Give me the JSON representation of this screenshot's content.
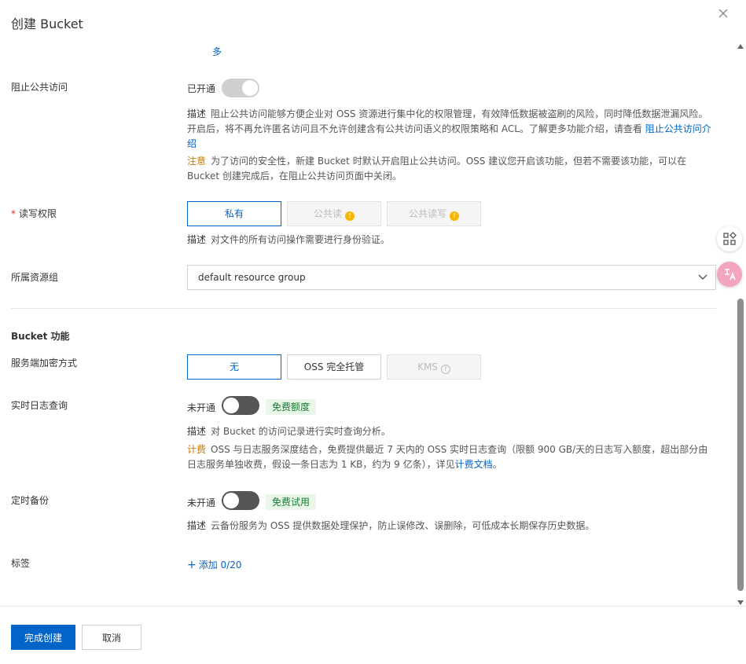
{
  "dialog": {
    "title": "创建 Bucket"
  },
  "top_overflow": {
    "more_text": "多"
  },
  "public_access": {
    "label": "阻止公共访问",
    "status": "已开通",
    "desc_tag": "描述",
    "desc_text": "阻止公共访问能够方便企业对 OSS 资源进行集中化的权限管理，有效降低数据被盗刷的风险，同时降低数据泄漏风险。开启后，将不再允许匿名访问且不允许创建含有公共访问语义的权限策略和 ACL。了解更多功能介绍，请查看",
    "desc_link": "阻止公共访问介绍",
    "note_tag": "注意",
    "note_text": "为了访问的安全性，新建 Bucket 时默认开启阻止公共访问。OSS 建议您开启该功能，但若不需要该功能，可以在 Bucket 创建完成后，在阻止公共访问页面中关闭。",
    "enabled": true
  },
  "acl": {
    "label": "读写权限",
    "options": [
      "私有",
      "公共读",
      "公共读写"
    ],
    "selected": "私有",
    "desc_tag": "描述",
    "desc_text": "对文件的所有访问操作需要进行身份验证。"
  },
  "resource_group": {
    "label": "所属资源组",
    "value": "default resource group"
  },
  "bucket_features": {
    "title": "Bucket 功能",
    "encryption": {
      "label": "服务端加密方式",
      "options": [
        "无",
        "OSS 完全托管",
        "KMS"
      ],
      "selected": "无"
    },
    "realtime_log": {
      "label": "实时日志查询",
      "status": "未开通",
      "badge": "免费额度",
      "desc_tag": "描述",
      "desc_text": "对 Bucket 的访问记录进行实时查询分析。",
      "billing_tag": "计费",
      "billing_text": "OSS 与日志服务深度结合，免费提供最近 7 天内的 OSS 实时日志查询（限额 900 GB/天的日志写入额度，超出部分由日志服务单独收费，假设一条日志为 1 KB，约为 9 亿条），详见",
      "billing_link": "计费文档",
      "billing_end": "。",
      "enabled": false
    },
    "scheduled_backup": {
      "label": "定时备份",
      "status": "未开通",
      "badge": "免费试用",
      "desc_tag": "描述",
      "desc_text": "云备份服务为 OSS 提供数据处理保护，防止误修改、误删除，可低成本长期保存历史数据。",
      "enabled": false
    },
    "tags": {
      "label": "标签",
      "add_text": "添加 0/20"
    }
  },
  "footer": {
    "create_label": "完成创建",
    "cancel_label": "取消"
  },
  "colors": {
    "accent": "#0064c8",
    "badge_bg": "#e8f7ea",
    "badge_text": "#1a7a2e",
    "warn": "#f5b800"
  }
}
